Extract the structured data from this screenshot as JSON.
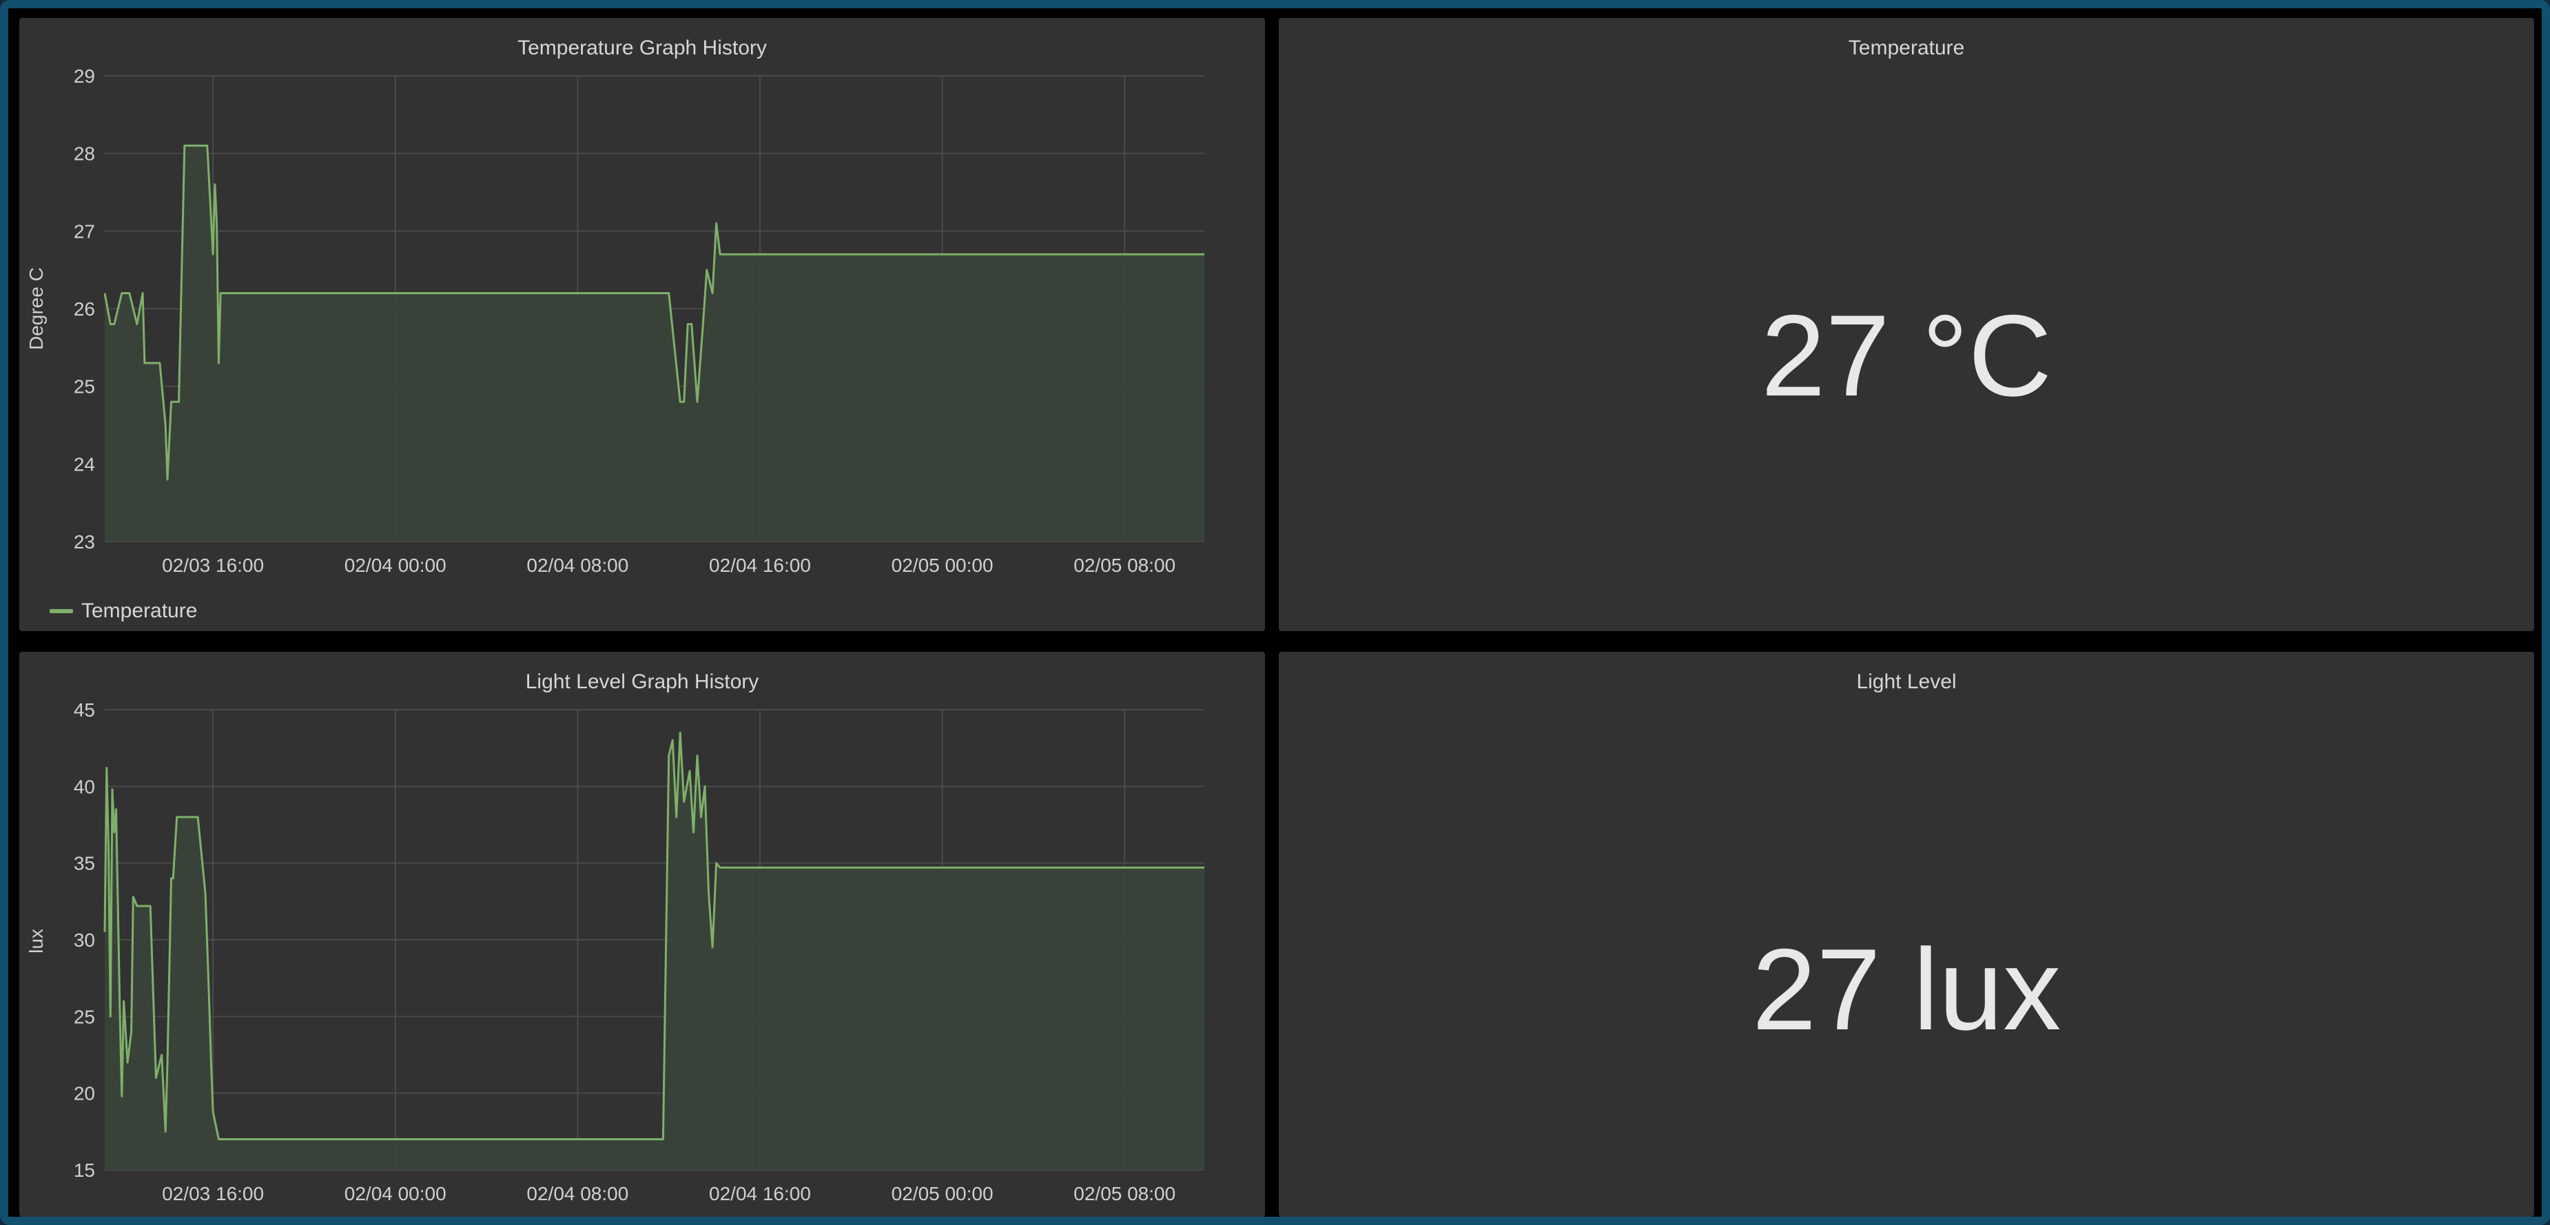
{
  "panels": {
    "temp_history": {
      "title": "Temperature Graph History",
      "legend_label": "Temperature"
    },
    "temp_current": {
      "title": "Temperature",
      "value": "27 °C"
    },
    "light_history": {
      "title": "Light Level Graph History"
    },
    "light_current": {
      "title": "Light Level",
      "value": "27 lux"
    }
  },
  "colors": {
    "line": "#7fb06a",
    "area": "#3a4438",
    "grid": "#4a4a4a",
    "panel_bg": "#323233",
    "frame_border": "#13506f"
  },
  "chart_data": [
    {
      "type": "area",
      "title": "Temperature Graph History",
      "xlabel": "",
      "ylabel": "Degree C",
      "x_tick_labels": [
        "02/03 16:00",
        "02/04 00:00",
        "02/04 08:00",
        "02/04 16:00",
        "02/05 00:00",
        "02/05 08:00"
      ],
      "ylim": [
        23,
        29
      ],
      "y_ticks": [
        23,
        24,
        25,
        26,
        27,
        28,
        29
      ],
      "grid": true,
      "legend": "bottom-left",
      "series": [
        {
          "name": "Temperature",
          "color": "#7fb06a",
          "x": [
            "02/03 11:15",
            "02/03 11:30",
            "02/03 11:40",
            "02/03 12:00",
            "02/03 12:20",
            "02/03 12:40",
            "02/03 12:55",
            "02/03 13:00",
            "02/03 13:15",
            "02/03 13:40",
            "02/03 13:55",
            "02/03 14:00",
            "02/03 14:10",
            "02/03 14:30",
            "02/03 14:45",
            "02/03 15:00",
            "02/03 15:20",
            "02/03 15:45",
            "02/03 16:00",
            "02/03 16:05",
            "02/03 16:10",
            "02/03 16:15",
            "02/03 16:20",
            "02/03 16:30",
            "02/03 16:40",
            "02/03 16:50",
            "02/04 12:00",
            "02/04 12:30",
            "02/04 12:40",
            "02/04 12:50",
            "02/04 13:00",
            "02/04 13:15",
            "02/04 13:30",
            "02/04 13:40",
            "02/04 13:55",
            "02/04 14:05",
            "02/04 14:15",
            "02/04 14:25",
            "02/04 14:35",
            "02/04 14:50",
            "02/05 11:30"
          ],
          "values": [
            26.2,
            25.8,
            25.8,
            26.2,
            26.2,
            25.8,
            26.2,
            25.3,
            25.3,
            25.3,
            24.5,
            23.8,
            24.8,
            24.8,
            28.1,
            28.1,
            28.1,
            28.1,
            26.7,
            27.6,
            27.1,
            25.3,
            26.2,
            26.2,
            26.2,
            26.2,
            26.2,
            24.8,
            24.8,
            25.8,
            25.8,
            24.8,
            25.8,
            26.5,
            26.2,
            27.1,
            26.7,
            26.7,
            26.7,
            26.7,
            26.7
          ]
        }
      ]
    },
    {
      "type": "area",
      "title": "Light Level Graph History",
      "xlabel": "",
      "ylabel": "lux",
      "x_tick_labels": [
        "02/03 16:00",
        "02/04 00:00",
        "02/04 08:00",
        "02/04 16:00",
        "02/05 00:00",
        "02/05 08:00"
      ],
      "ylim": [
        15,
        45
      ],
      "y_ticks": [
        15,
        20,
        25,
        30,
        35,
        40,
        45
      ],
      "grid": true,
      "series": [
        {
          "name": "",
          "color": "#7fb06a",
          "x": [
            "02/03 11:15",
            "02/03 11:20",
            "02/03 11:25",
            "02/03 11:30",
            "02/03 11:35",
            "02/03 11:40",
            "02/03 11:45",
            "02/03 11:55",
            "02/03 12:00",
            "02/03 12:05",
            "02/03 12:15",
            "02/03 12:25",
            "02/03 12:30",
            "02/03 12:40",
            "02/03 13:00",
            "02/03 13:15",
            "02/03 13:30",
            "02/03 13:45",
            "02/03 13:55",
            "02/03 14:00",
            "02/03 14:10",
            "02/03 14:15",
            "02/03 14:25",
            "02/03 14:35",
            "02/03 14:45",
            "02/03 14:55",
            "02/03 15:05",
            "02/03 15:20",
            "02/03 15:40",
            "02/03 15:50",
            "02/03 15:55",
            "02/03 16:00",
            "02/03 16:15",
            "02/03 16:30",
            "02/04 11:30",
            "02/04 11:45",
            "02/04 12:00",
            "02/04 12:10",
            "02/04 12:20",
            "02/04 12:30",
            "02/04 12:40",
            "02/04 12:55",
            "02/04 13:05",
            "02/04 13:15",
            "02/04 13:25",
            "02/04 13:35",
            "02/04 13:45",
            "02/04 13:55",
            "02/04 14:05",
            "02/04 14:15",
            "02/04 14:30",
            "02/04 14:45",
            "02/05 11:30"
          ],
          "values": [
            30.5,
            41.2,
            36.0,
            25.0,
            39.8,
            37.0,
            38.5,
            25.0,
            19.8,
            26.0,
            22.0,
            24.0,
            32.8,
            32.2,
            32.2,
            32.2,
            21.0,
            22.5,
            17.5,
            22.0,
            34.0,
            34.0,
            38.0,
            38.0,
            38.0,
            38.0,
            38.0,
            38.0,
            33.0,
            26.0,
            22.0,
            18.8,
            17.0,
            17.0,
            17.0,
            17.0,
            42.0,
            43.0,
            38.0,
            43.5,
            39.0,
            41.0,
            37.0,
            42.0,
            38.0,
            40.0,
            33.0,
            29.5,
            35.0,
            34.7,
            34.7,
            34.7,
            34.7
          ]
        }
      ]
    }
  ]
}
